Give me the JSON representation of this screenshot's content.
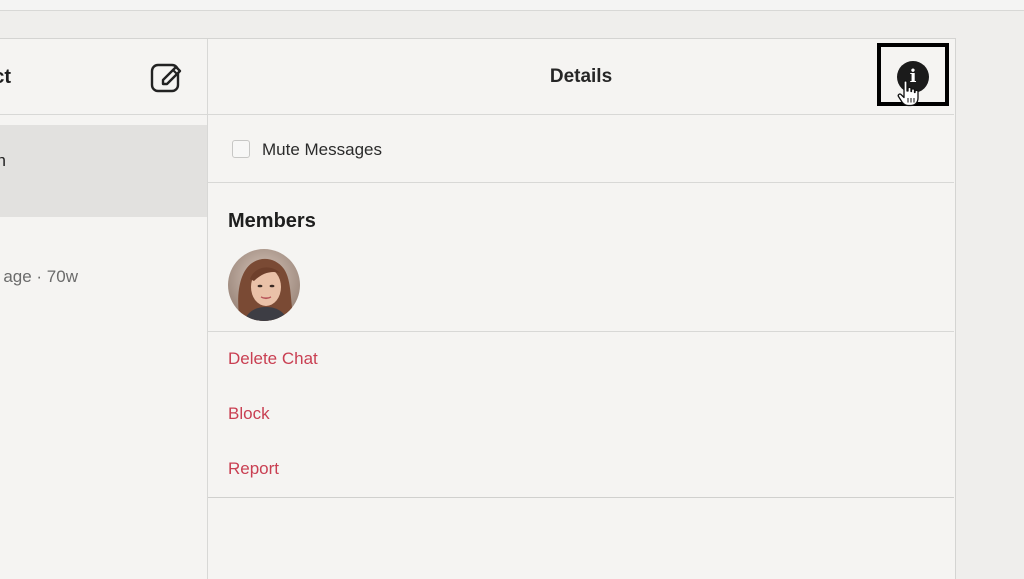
{
  "sidebar": {
    "title": "ct",
    "conversations": [
      {
        "name": "n"
      },
      {
        "preview": "age · 70w"
      }
    ]
  },
  "details": {
    "title": "Details",
    "mute_label": "Mute Messages",
    "mute_checked": false,
    "members_title": "Members",
    "actions": {
      "delete_chat": "Delete Chat",
      "block": "Block",
      "report": "Report"
    }
  },
  "colors": {
    "action_red": "#c93f52",
    "background": "#f5f4f2",
    "info_button": "#1b1b1b"
  },
  "icons": {
    "compose": "compose-icon",
    "info": "info-icon",
    "cursor": "hand-cursor-icon"
  }
}
